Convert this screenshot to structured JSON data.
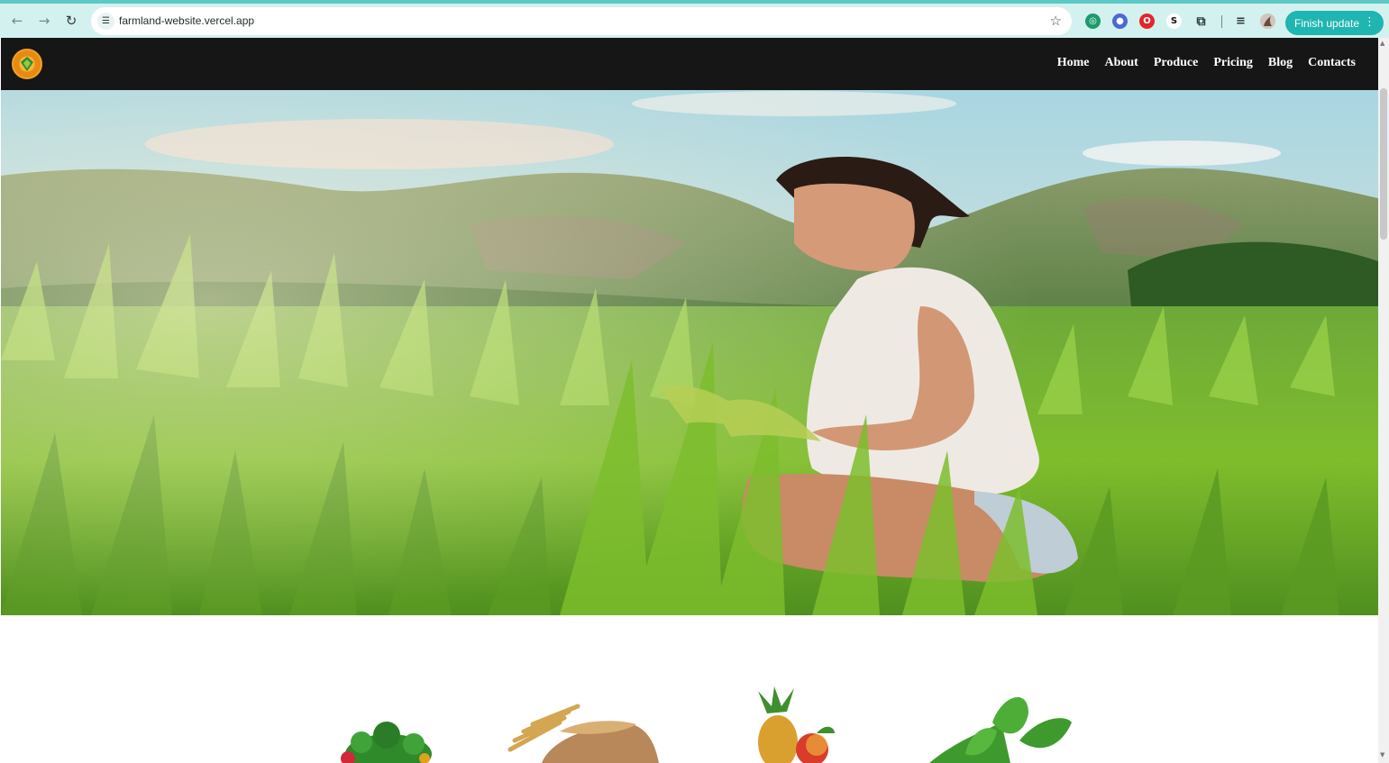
{
  "browser": {
    "url": "farmland-website.vercel.app",
    "update_button": "Finish update",
    "extensions": [
      "chatgpt-icon",
      "vpn-icon",
      "opera-icon",
      "s-icon",
      "puzzle-icon",
      "media-icon",
      "profile-avatar"
    ]
  },
  "site": {
    "logo_alt": "Farmland logo",
    "nav": [
      "Home",
      "About",
      "Produce",
      "Pricing",
      "Blog",
      "Contacts"
    ],
    "hero_image": "woman-in-rice-field",
    "products": [
      "vegetables",
      "grain-sack",
      "fruits",
      "leafy-greens"
    ]
  },
  "colors": {
    "accent": "#1fb5b0",
    "header_bg": "#161616",
    "chrome_bg": "#d3f1ef"
  }
}
